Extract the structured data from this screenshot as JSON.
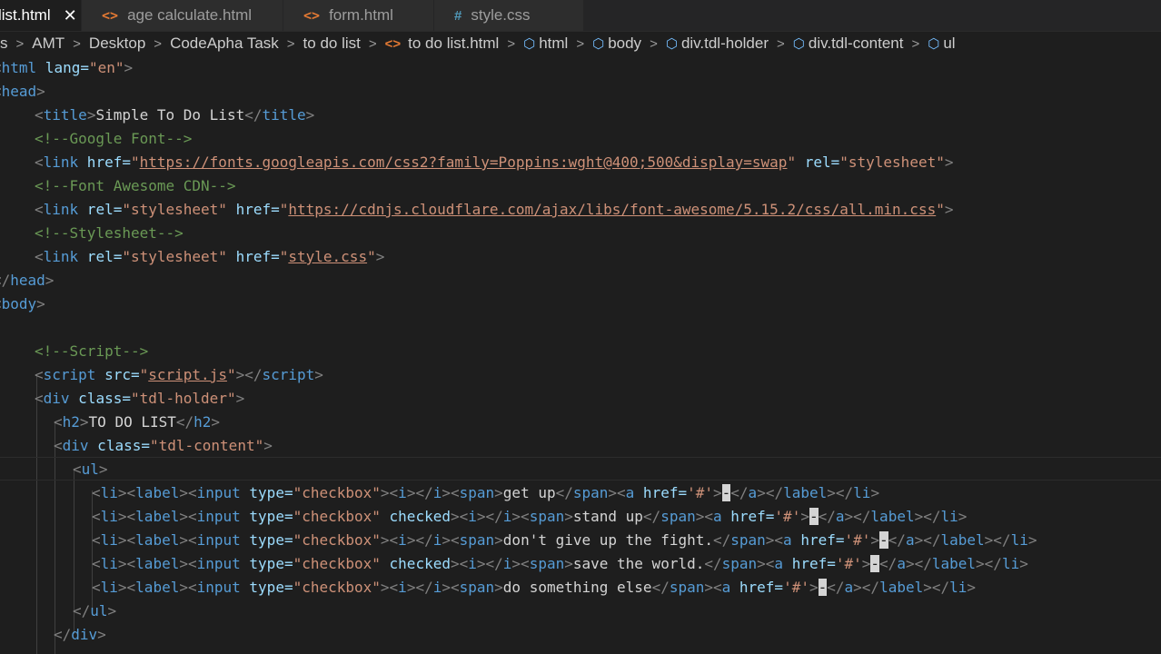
{
  "tabs": [
    {
      "label": "list.html",
      "close": "✕",
      "icon": ""
    },
    {
      "label": "age calculate.html",
      "icon": "<>"
    },
    {
      "label": "form.html",
      "icon": "<>"
    },
    {
      "label": "style.css",
      "icon": "#"
    }
  ],
  "breadcrumb": {
    "items": [
      "s",
      "AMT",
      "Desktop",
      "CodeApha Task",
      "to do list",
      "to do list.html",
      "html",
      "body",
      "div.tdl-holder",
      "div.tdl-content",
      "ul"
    ],
    "separator": ">"
  },
  "code": {
    "l0": {
      "open": "<",
      "tag": "html",
      "attr": " lang=",
      "val": "\"en\"",
      "close": ">"
    },
    "l1": {
      "open": "<",
      "tag": "head",
      "close": ">"
    },
    "l2": {
      "open": "<",
      "tag": "title",
      "close": ">",
      "text": "Simple To Do List",
      "open2": "</",
      "tag2": "title",
      "close2": ">"
    },
    "l3": {
      "comment": "<!--Google Font-->"
    },
    "l4": {
      "open": "<",
      "tag": "link",
      "attr": " href=",
      "q1": "\"",
      "url": "https://fonts.googleapis.com/css2?family=Poppins:wght@400;500&display=swap",
      "q2": "\"",
      "attr2": " rel=",
      "val2": "\"stylesheet\"",
      "close": ">"
    },
    "l5": {
      "comment": "<!--Font Awesome CDN-->"
    },
    "l6": {
      "open": "<",
      "tag": "link",
      "attr": " rel=",
      "val": "\"stylesheet\"",
      "attr2": " href=",
      "q1": "\"",
      "url": "https://cdnjs.cloudflare.com/ajax/libs/font-awesome/5.15.2/css/all.min.css",
      "q2": "\"",
      "close": ">"
    },
    "l7": {
      "comment": "<!--Stylesheet-->"
    },
    "l8": {
      "open": "<",
      "tag": "link",
      "attr": " rel=",
      "val": "\"stylesheet\"",
      "attr2": " href=",
      "q1": "\"",
      "url": "style.css",
      "q2": "\"",
      "close": ">"
    },
    "l9": {
      "open": "</",
      "tag": "head",
      "close": ">"
    },
    "l10": {
      "open": "<",
      "tag": "body",
      "close": ">"
    },
    "l12": {
      "comment": "<!--Script-->"
    },
    "l13": {
      "open": "<",
      "tag": "script",
      "attr": " src=",
      "q1": "\"",
      "url": "script.js",
      "q2": "\"",
      "close": ">",
      "open2": "</",
      "tag2": "script",
      "close2": ">"
    },
    "l14": {
      "open": "<",
      "tag": "div",
      "attr": " class=",
      "val": "\"tdl-holder\"",
      "close": ">"
    },
    "l15": {
      "open": "<",
      "tag": "h2",
      "close": ">",
      "text": "TO DO LIST",
      "open2": "</",
      "tag2": "h2",
      "close2": ">"
    },
    "l16": {
      "open": "<",
      "tag": "div",
      "attr": " class=",
      "val": "\"tdl-content\"",
      "close": ">"
    },
    "l17": {
      "open": "<",
      "tag": "ul",
      "close": ">"
    },
    "items": [
      {
        "checked": "",
        "text": "get up"
      },
      {
        "checked": " checked",
        "text": "stand up"
      },
      {
        "checked": "",
        "text": "don't give up the fight."
      },
      {
        "checked": " checked",
        "text": "save the world."
      },
      {
        "checked": "",
        "text": "do something else"
      }
    ],
    "li": {
      "a": "<",
      "li": "li",
      "b": "><",
      "label": "label",
      "c": "><",
      "input": "input",
      "type": " type=",
      "checkbox": "\"checkbox\"",
      "d": "><",
      "i": "i",
      "e": "></",
      "i2": "i",
      "f": "><",
      "span": "span",
      "g": ">",
      "h": "</",
      "span2": "span",
      "k": "><",
      "a_tag": "a",
      "href": " href=",
      "hash": "'#'",
      "m": ">",
      "cursor": "-",
      "n": "</",
      "a2": "a",
      "o": "></",
      "label2": "label",
      "p": "></",
      "li2": "li",
      "q": ">"
    },
    "l23": {
      "open": "</",
      "tag": "ul",
      "close": ">"
    },
    "l24": {
      "open": "</",
      "tag": "div",
      "close": ">"
    }
  }
}
